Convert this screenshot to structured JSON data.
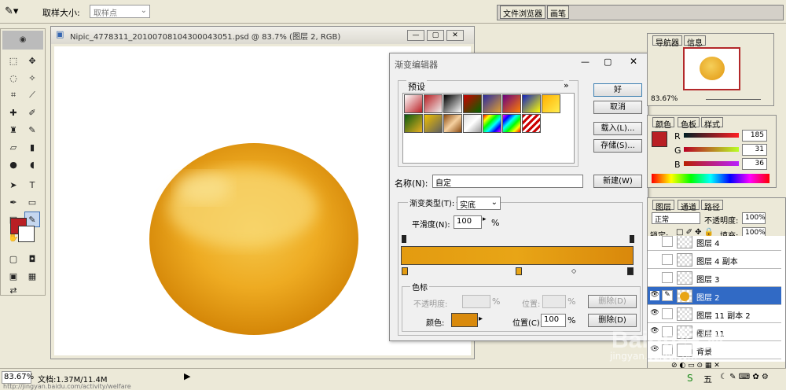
{
  "options_bar": {
    "tool_icon": "eyedropper-icon",
    "sample_size_label": "取样大小:",
    "sample_size_value": "取样点"
  },
  "panel_well": {
    "tabs": [
      "文件浏览器",
      "画笔"
    ]
  },
  "document": {
    "title": "Nipic_4778311_20100708104300043051.psd @ 83.7% (图层 2, RGB)"
  },
  "status_bar": {
    "zoom": "83.67%",
    "doc_info": "文档:1.37M/11.4M",
    "url": "http://jingyan.baidu.com/activity/welfare"
  },
  "gradient_editor": {
    "title": "渐变编辑器",
    "presets_label": "预设",
    "buttons": {
      "ok": "好",
      "cancel": "取消",
      "load": "载入(L)...",
      "save": "存储(S)...",
      "new": "新建(W)",
      "delete_opacity": "删除(D)",
      "delete_color": "删除(D)"
    },
    "name_label": "名称(N):",
    "name_value": "自定",
    "type_label": "渐变类型(T):",
    "type_value": "实底",
    "smooth_label": "平滑度(N):",
    "smooth_value": "100",
    "percent": "%",
    "stops_label": "色标",
    "opacity_label": "不透明度:",
    "location_label": "位置:",
    "color_label": "颜色:",
    "location_c_label": "位置(C):",
    "location_c_value": "100",
    "stop_color": "#d98a0c",
    "gradient_colors": [
      "#e39b10",
      "#e8a516",
      "#d9880b"
    ]
  },
  "navigator": {
    "tabs": [
      "导航器",
      "信息"
    ],
    "zoom": "83.67%"
  },
  "color_panel": {
    "tabs": [
      "颜色",
      "色板",
      "样式"
    ],
    "r_label": "R",
    "g_label": "G",
    "b_label": "B",
    "r": "185",
    "g": "31",
    "b": "36",
    "fg": "#b91f24"
  },
  "layers_panel": {
    "tabs": [
      "图层",
      "通道",
      "路径"
    ],
    "blend_mode": "正常",
    "opacity_label": "不透明度:",
    "opacity_value": "100%",
    "lock_label": "锁定:",
    "fill_label": "填充:",
    "fill_value": "100%",
    "layers": [
      {
        "name": "图层 4"
      },
      {
        "name": "图层 4 副本"
      },
      {
        "name": "图层 3"
      },
      {
        "name": "图层 2"
      },
      {
        "name": "图层 11 副本 2"
      },
      {
        "name": "图层 11"
      },
      {
        "name": "背景"
      }
    ]
  },
  "taskbar": {
    "ime": "五"
  },
  "watermark": {
    "text": "Baidu经验",
    "url": "jingyan.baidu.com"
  }
}
